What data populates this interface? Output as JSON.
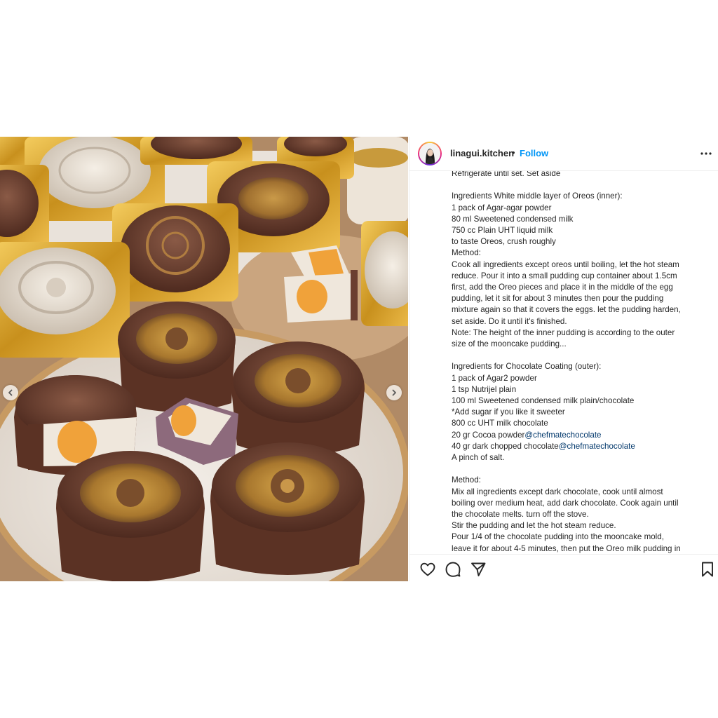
{
  "post": {
    "username": "linagui.kitchen",
    "separator": "•",
    "follow_label": "Follow",
    "image_alt": "Chocolate mooncake puddings with golden embossed tops, some cut open showing an orange egg-yolk center, in gold trays on a marble plate",
    "icons": {
      "more": "more-options-icon",
      "prev": "chevron-left-icon",
      "next": "chevron-right-icon",
      "like": "heart-icon",
      "comment": "comment-icon",
      "share": "send-icon",
      "save": "bookmark-icon"
    },
    "caption_lines": [
      "Refrigerate until set. Set aside",
      "",
      "Ingredients White middle layer of Oreos (inner):",
      "1 pack of Agar-agar powder",
      "80 ml Sweetened condensed milk",
      "750 cc Plain UHT liquid milk",
      "to taste Oreos, crush roughly",
      "Method:",
      "Cook all ingredients except oreos until boiling, let the hot steam",
      "reduce. Pour it into a small pudding cup container about 1.5cm",
      "first, add the Oreo pieces and place it in the middle of the egg",
      "pudding, let it sit for about 3 minutes then pour the pudding",
      "mixture again so that it covers the eggs. let the pudding harden,",
      "set aside. Do it until it's finished.",
      "Note: The height of the inner pudding is according to the outer",
      "size of the mooncake pudding...",
      "",
      "Ingredients for Chocolate Coating (outer):",
      "1 pack of Agar2 powder",
      "1 tsp Nutrijel plain",
      "100 ml Sweetened condensed milk plain/chocolate",
      "*Add sugar if you like it sweeter",
      "800 cc UHT milk chocolate",
      "",
      "",
      "A pinch of salt.",
      "",
      "Method:",
      "Mix all ingredients except dark chocolate, cook until almost",
      "boiling over medium heat, add dark chocolate. Cook again until",
      "the chocolate melts. turn off the stove.",
      "Stir the pudding and let the hot steam reduce.",
      "Pour 1/4 of the chocolate pudding into the mooncake mold,",
      "leave it for about 4-5 minutes, then put the Oreo milk pudding in"
    ],
    "cocoa_line": {
      "text": "20 gr Cocoa powder",
      "mention": "@chefmatechocolate"
    },
    "dark_choc_line": {
      "text": "40 gr dark chopped chocolate",
      "mention": "@chefmatechocolate"
    },
    "colors": {
      "follow": "#0095f6",
      "mention": "#00376b",
      "text": "#262626"
    }
  }
}
